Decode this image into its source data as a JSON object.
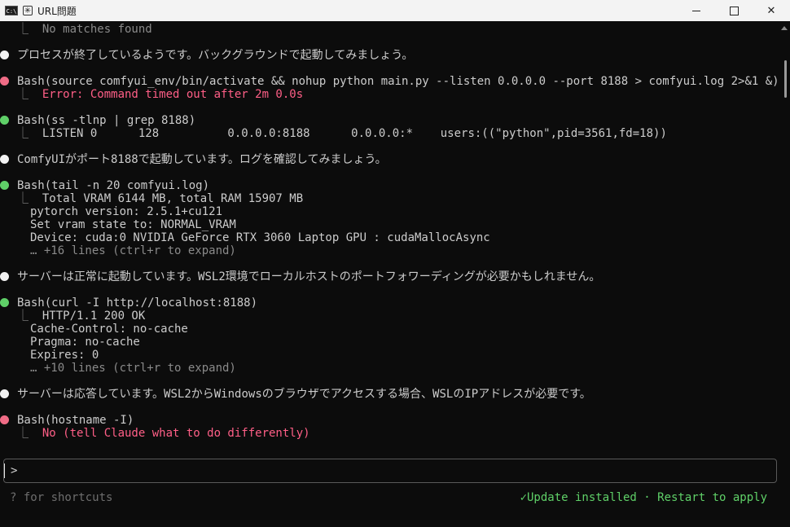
{
  "window": {
    "app_icon_text": "C:\\",
    "tab_icon": "✳",
    "title": "URL問題",
    "minimize_icon": "minimize-icon",
    "maximize_icon": "maximize-icon",
    "close_icon": "✕"
  },
  "colors": {
    "background": "#0c0c0c",
    "bullet_white": "#f2f2f2",
    "bullet_green": "#5fd068",
    "bullet_red": "#f06c86",
    "error": "#ff5f87",
    "dim": "#8a8a8a",
    "success": "#5fd068"
  },
  "transcript": {
    "no_matches": "⎿  No matches found",
    "msg1": "プロセスが終了しているようです。バックグラウンドで起動してみましょう。",
    "bash1_cmd": "Bash(source comfyui_env/bin/activate && nohup python main.py --listen 0.0.0.0 --port 8188 > comfyui.log 2>&1 &)",
    "bash1_err": "Error: Command timed out after 2m 0.0s",
    "bash2_cmd": "Bash(ss -tlnp | grep 8188)",
    "bash2_out": "LISTEN 0      128          0.0.0.0:8188      0.0.0.0:*    users:((\"python\",pid=3561,fd=18))",
    "msg2": "ComfyUIがポート8188で起動しています。ログを確認してみましょう。",
    "bash3_cmd": "Bash(tail -n 20 comfyui.log)",
    "bash3_out1": "Total VRAM 6144 MB, total RAM 15907 MB",
    "bash3_out2": "pytorch version: 2.5.1+cu121",
    "bash3_out3": "Set vram state to: NORMAL_VRAM",
    "bash3_out4": "Device: cuda:0 NVIDIA GeForce RTX 3060 Laptop GPU : cudaMallocAsync",
    "bash3_more": "… +16 lines (ctrl+r to expand)",
    "msg3": "サーバーは正常に起動しています。WSL2環境でローカルホストのポートフォワーディングが必要かもしれません。",
    "bash4_cmd": "Bash(curl -I http://localhost:8188)",
    "bash4_out1": "HTTP/1.1 200 OK",
    "bash4_out2": "Cache-Control: no-cache",
    "bash4_out3": "Pragma: no-cache",
    "bash4_out4": "Expires: 0",
    "bash4_more": "… +10 lines (ctrl+r to expand)",
    "msg4": "サーバーは応答しています。WSL2からWindowsのブラウザでアクセスする場合、WSLのIPアドレスが必要です。",
    "bash5_cmd": "Bash(hostname -I)",
    "bash5_err": "No (tell Claude what to do differently)",
    "corner_glyph": "⎿"
  },
  "input": {
    "prompt": ">",
    "value": ""
  },
  "footer": {
    "shortcuts_hint": "? for shortcuts",
    "update_status": "✓Update installed · Restart to apply"
  }
}
